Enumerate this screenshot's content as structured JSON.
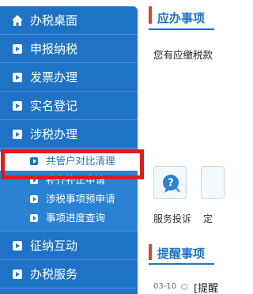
{
  "sidebar": {
    "items": [
      {
        "label": "办税桌面",
        "icon": "home-icon"
      },
      {
        "label": "申报纳税",
        "icon": "play-bullet-icon"
      },
      {
        "label": "发票办理",
        "icon": "play-bullet-icon"
      },
      {
        "label": "实名登记",
        "icon": "play-bullet-icon"
      },
      {
        "label": "涉税办理",
        "icon": "play-bullet-icon"
      },
      {
        "label": "征纳互动",
        "icon": "play-bullet-icon"
      },
      {
        "label": "办税服务",
        "icon": "play-bullet-icon"
      }
    ],
    "submenu": [
      {
        "label": "共管户对比清理",
        "selected": true
      },
      {
        "label": "补齐补正申请",
        "selected": false
      },
      {
        "label": "涉税事项预申请",
        "selected": false
      },
      {
        "label": "事项进度查询",
        "selected": false
      }
    ]
  },
  "todo": {
    "title": "应办事项",
    "text": "您有应缴税款"
  },
  "services": [
    {
      "label": "服务投诉",
      "icon": "complaint-icon"
    },
    {
      "label": "定",
      "icon": "service-icon"
    }
  ],
  "reminders": {
    "title": "提醒事项",
    "items": [
      {
        "date": "03-10",
        "text": "[提醒"
      }
    ]
  },
  "colors": {
    "sidebar_bg": "#1e73c6",
    "highlight": "#e11a1a",
    "accent": "#e8431a"
  }
}
